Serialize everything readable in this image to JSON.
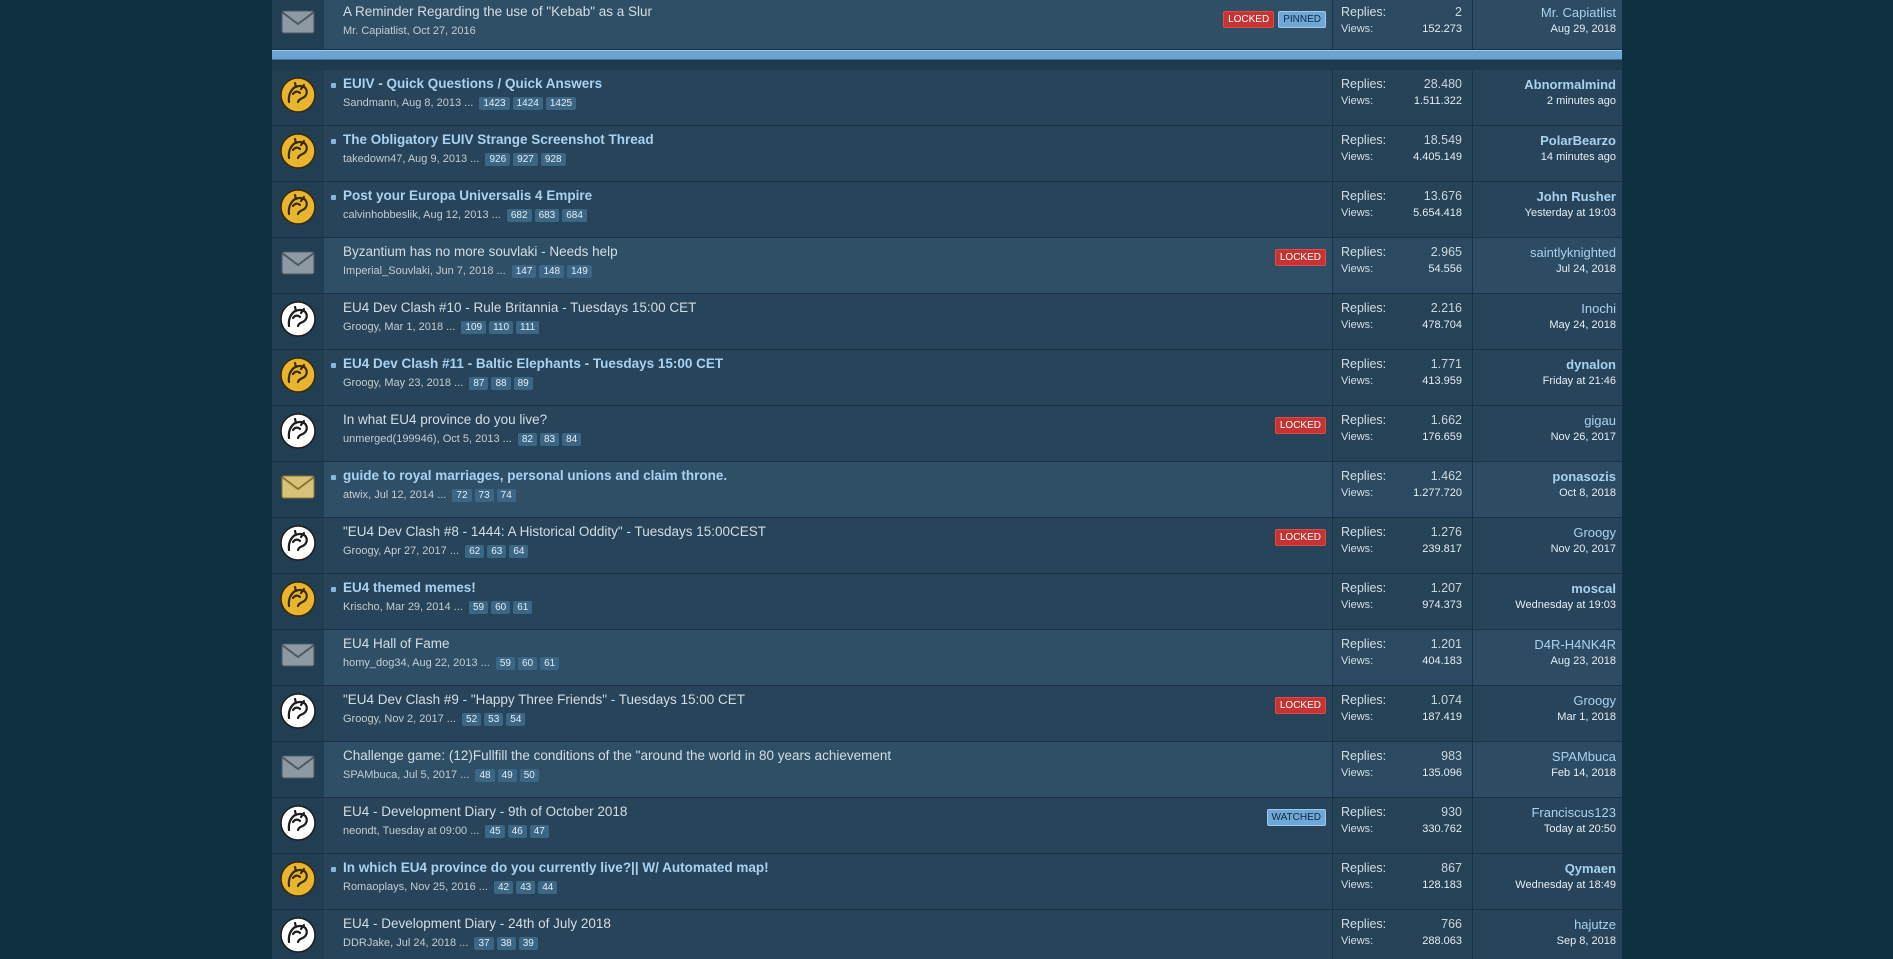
{
  "threads_sticky": [
    {
      "title": "A Reminder Regarding the use of \"Kebab\" as a Slur",
      "author": "Mr. Capiatlist",
      "date": "Oct 27, 2016",
      "pages": [],
      "badges": [
        "LOCKED",
        "PINNED"
      ],
      "replies": "2",
      "views": "152.273",
      "last_user": "Mr. Capiatlist",
      "last_date": "Aug 29, 2018",
      "icon": "envelope-icon",
      "unread": false,
      "alt": true
    }
  ],
  "threads": [
    {
      "title": "EUIV - Quick Questions / Quick Answers",
      "author": "Sandmann",
      "date": "Aug 8, 2013",
      "pages": [
        "1423",
        "1424",
        "1425"
      ],
      "badges": [],
      "replies": "28.480",
      "views": "1.511.322",
      "last_user": "Abnormalmind",
      "last_date": "2 minutes ago",
      "icon": "lion-gold-icon",
      "unread": true,
      "alt": false
    },
    {
      "title": "The Obligatory EUIV Strange Screenshot Thread",
      "author": "takedown47",
      "date": "Aug 9, 2013",
      "pages": [
        "926",
        "927",
        "928"
      ],
      "badges": [],
      "replies": "18.549",
      "views": "4.405.149",
      "last_user": "PolarBearzo",
      "last_date": "14 minutes ago",
      "icon": "lion-gold-icon",
      "unread": true,
      "alt": false
    },
    {
      "title": "Post your Europa Universalis 4 Empire",
      "author": "calvinhobbeslik",
      "date": "Aug 12, 2013",
      "pages": [
        "682",
        "683",
        "684"
      ],
      "badges": [],
      "replies": "13.676",
      "views": "5.654.418",
      "last_user": "John Rusher",
      "last_date": "Yesterday at 19:03",
      "icon": "lion-gold-icon",
      "unread": true,
      "alt": false
    },
    {
      "title": "Byzantium has no more souvlaki - Needs help",
      "author": "Imperial_Souvlaki",
      "date": "Jun 7, 2018",
      "pages": [
        "147",
        "148",
        "149"
      ],
      "badges": [
        "LOCKED"
      ],
      "replies": "2.965",
      "views": "54.556",
      "last_user": "saintlyknighted",
      "last_date": "Jul 24, 2018",
      "icon": "envelope-icon",
      "unread": false,
      "alt": true
    },
    {
      "title": "EU4 Dev Clash #10 - Rule Britannia - Tuesdays 15:00 CET",
      "author": "Groogy",
      "date": "Mar 1, 2018",
      "pages": [
        "109",
        "110",
        "111"
      ],
      "badges": [],
      "replies": "2.216",
      "views": "478.704",
      "last_user": "Inochi",
      "last_date": "May 24, 2018",
      "icon": "lion-white-icon",
      "unread": false,
      "alt": false
    },
    {
      "title": "EU4 Dev Clash #11 - Baltic Elephants - Tuesdays 15:00 CET",
      "author": "Groogy",
      "date": "May 23, 2018",
      "pages": [
        "87",
        "88",
        "89"
      ],
      "badges": [],
      "replies": "1.771",
      "views": "413.959",
      "last_user": "dynalon",
      "last_date": "Friday at 21:46",
      "icon": "lion-gold-icon",
      "unread": true,
      "alt": false
    },
    {
      "title": "In what EU4 province do you live?",
      "author": "unmerged(199946)",
      "date": "Oct 5, 2013",
      "pages": [
        "82",
        "83",
        "84"
      ],
      "badges": [
        "LOCKED"
      ],
      "replies": "1.662",
      "views": "176.659",
      "last_user": "gigau",
      "last_date": "Nov 26, 2017",
      "icon": "lion-white-icon",
      "unread": false,
      "alt": false
    },
    {
      "title": "guide to royal marriages, personal unions and claim throne.",
      "author": "atwix",
      "date": "Jul 12, 2014",
      "pages": [
        "72",
        "73",
        "74"
      ],
      "badges": [],
      "replies": "1.462",
      "views": "1.277.720",
      "last_user": "ponasozis",
      "last_date": "Oct 8, 2018",
      "icon": "envelope-gold-icon",
      "unread": true,
      "alt": true
    },
    {
      "title": "\"EU4 Dev Clash #8 - 1444: A Historical Oddity\" - Tuesdays 15:00CEST",
      "author": "Groogy",
      "date": "Apr 27, 2017",
      "pages": [
        "62",
        "63",
        "64"
      ],
      "badges": [
        "LOCKED"
      ],
      "replies": "1.276",
      "views": "239.817",
      "last_user": "Groogy",
      "last_date": "Nov 20, 2017",
      "icon": "lion-white-icon",
      "unread": false,
      "alt": false
    },
    {
      "title": "EU4 themed memes!",
      "author": "Krischo",
      "date": "Mar 29, 2014",
      "pages": [
        "59",
        "60",
        "61"
      ],
      "badges": [],
      "replies": "1.207",
      "views": "974.373",
      "last_user": "moscal",
      "last_date": "Wednesday at 19:03",
      "icon": "lion-gold-icon",
      "unread": true,
      "alt": false
    },
    {
      "title": "EU4 Hall of Fame",
      "author": "homy_dog34",
      "date": "Aug 22, 2013",
      "pages": [
        "59",
        "60",
        "61"
      ],
      "badges": [],
      "replies": "1.201",
      "views": "404.183",
      "last_user": "D4R-H4NK4R",
      "last_date": "Aug 23, 2018",
      "icon": "envelope-icon",
      "unread": false,
      "alt": true
    },
    {
      "title": "\"EU4 Dev Clash #9 - \"Happy Three Friends\" - Tuesdays 15:00 CET",
      "author": "Groogy",
      "date": "Nov 2, 2017",
      "pages": [
        "52",
        "53",
        "54"
      ],
      "badges": [
        "LOCKED"
      ],
      "replies": "1.074",
      "views": "187.419",
      "last_user": "Groogy",
      "last_date": "Mar 1, 2018",
      "icon": "lion-white-icon",
      "unread": false,
      "alt": false
    },
    {
      "title": "Challenge game: (12)Fullfill the conditions of the \"around the world in 80 years achievement",
      "author": "SPAMbuca",
      "date": "Jul 5, 2017",
      "pages": [
        "48",
        "49",
        "50"
      ],
      "badges": [],
      "replies": "983",
      "views": "135.096",
      "last_user": "SPAMbuca",
      "last_date": "Feb 14, 2018",
      "icon": "envelope-icon",
      "unread": false,
      "alt": true
    },
    {
      "title": "EU4 - Development Diary - 9th of October 2018",
      "author": "neondt",
      "date": "Tuesday at 09:00",
      "pages": [
        "45",
        "46",
        "47"
      ],
      "badges": [
        "WATCHED"
      ],
      "replies": "930",
      "views": "330.762",
      "last_user": "Franciscus123",
      "last_date": "Today at 20:50",
      "icon": "lion-white-icon",
      "unread": false,
      "alt": false
    },
    {
      "title": "In which EU4 province do you currently live?|| W/ Automated map!",
      "author": "Romaoplays",
      "date": "Nov 25, 2016",
      "pages": [
        "42",
        "43",
        "44"
      ],
      "badges": [],
      "replies": "867",
      "views": "128.183",
      "last_user": "Qymaen",
      "last_date": "Wednesday at 18:49",
      "icon": "lion-gold-icon",
      "unread": true,
      "alt": false
    },
    {
      "title": "EU4 - Development Diary - 24th of July 2018",
      "author": "DDRJake",
      "date": "Jul 24, 2018",
      "pages": [
        "37",
        "38",
        "39"
      ],
      "badges": [],
      "replies": "766",
      "views": "288.063",
      "last_user": "hajutze",
      "last_date": "Sep 8, 2018",
      "icon": "lion-white-icon",
      "unread": false,
      "alt": false
    }
  ],
  "labels": {
    "replies": "Replies:",
    "views": "Views:",
    "ellipsis": "..."
  }
}
